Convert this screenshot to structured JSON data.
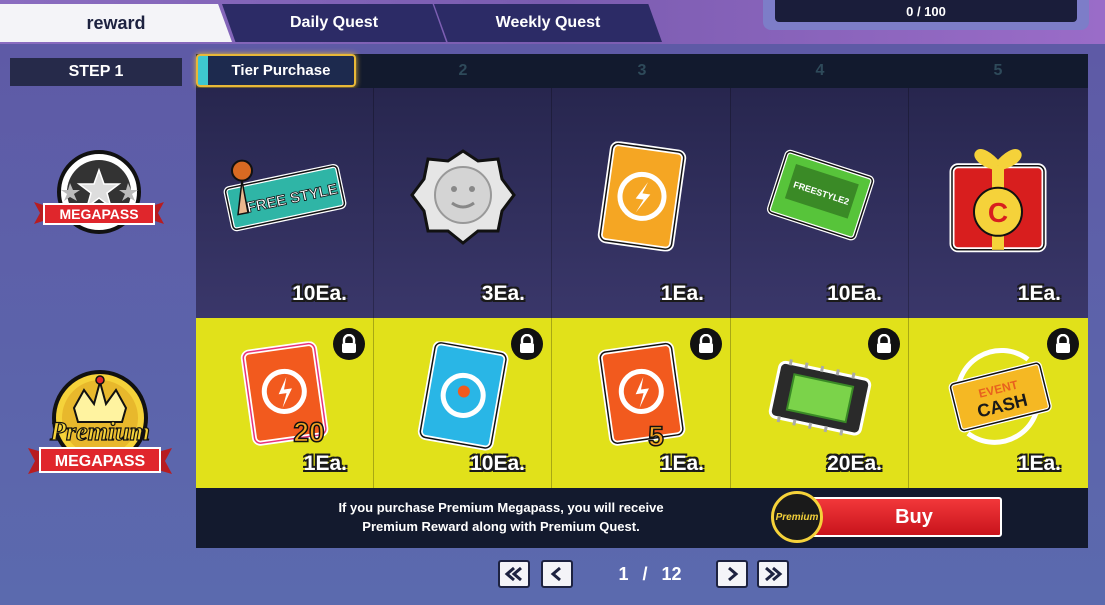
{
  "tabs": {
    "reward": "reward",
    "daily": "Daily Quest",
    "weekly": "Weekly Quest"
  },
  "progress": {
    "text": "0 / 100",
    "value": 0,
    "max": 100
  },
  "step": {
    "label": "STEP 1"
  },
  "tier_purchase": "Tier Purchase",
  "columns": [
    "2",
    "3",
    "4",
    "5"
  ],
  "megapass_badge": {
    "label": "MEGAPASS"
  },
  "premium_badge": {
    "script": "Premium",
    "label": "MEGAPASS"
  },
  "free_rewards": [
    {
      "icon": "freestyle-ticket-icon",
      "qty": "10Ea."
    },
    {
      "icon": "silver-coin-icon",
      "qty": "3Ea."
    },
    {
      "icon": "gold-swap-card-icon",
      "qty": "1Ea."
    },
    {
      "icon": "green-cartridge-icon",
      "qty": "10Ea."
    },
    {
      "icon": "red-gift-box-icon",
      "qty": "1Ea."
    }
  ],
  "premium_rewards": [
    {
      "icon": "orange-swap-card-20-icon",
      "qty": "1Ea.",
      "badge": "20"
    },
    {
      "icon": "blue-swap-card-icon",
      "qty": "10Ea."
    },
    {
      "icon": "orange-swap-card-5-icon",
      "qty": "1Ea.",
      "badge": "5"
    },
    {
      "icon": "microchip-icon",
      "qty": "20Ea."
    },
    {
      "icon": "event-cash-ticket-icon",
      "qty": "1Ea.",
      "line1": "EVENT",
      "line2": "CASH"
    }
  ],
  "footer": {
    "line1": "If you purchase Premium Megapass, you will receive",
    "line2": "Premium Reward along with Premium Quest.",
    "buy_label": "Buy",
    "buy_badge": "Premium"
  },
  "pager": {
    "current": "1",
    "sep": "/",
    "total": "12"
  },
  "freestyle_text": "FREE STYLE",
  "cartridge_text": "FREESTYLE2",
  "colors": {
    "accent": "#e1e11a",
    "buy": "#e2262c",
    "tier_border": "#e8b838"
  }
}
